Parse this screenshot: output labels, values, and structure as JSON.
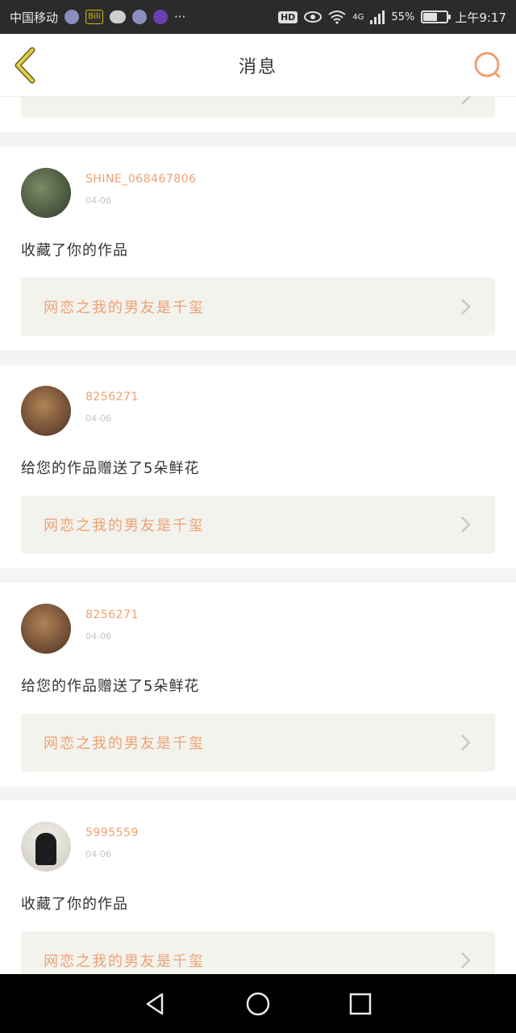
{
  "status_bar": {
    "carrier": "中国移动",
    "app_badge": "Bili",
    "hd": "HD",
    "network": "4G",
    "battery_percent": "55%",
    "time": "上午9:17",
    "battery_level": 0.55,
    "more": "···"
  },
  "header": {
    "title": "消息"
  },
  "notifications": [
    {
      "username": "SHINE_068467806",
      "date": "04-06",
      "message": "收藏了你的作品",
      "work_title": "网恋之我的男友是千玺"
    },
    {
      "username": "8256271",
      "date": "04-06",
      "message": "给您的作品赠送了5朵鲜花",
      "work_title": "网恋之我的男友是千玺"
    },
    {
      "username": "8256271",
      "date": "04-06",
      "message": "给您的作品赠送了5朵鲜花",
      "work_title": "网恋之我的男友是千玺"
    },
    {
      "username": "5995559",
      "date": "04-06",
      "message": "收藏了你的作品",
      "work_title": "网恋之我的男友是千玺"
    }
  ],
  "colors": {
    "accent": "#f0a070",
    "back_icon": "#d8c23a",
    "search_icon": "#f0a070",
    "card_bar": "#f3f3ee"
  },
  "icons": {
    "back": "chevron-left-icon",
    "search": "search-icon",
    "chevron": "chevron-right-icon",
    "nav_back": "triangle-back-icon",
    "nav_home": "circle-home-icon",
    "nav_recent": "square-recent-icon"
  }
}
